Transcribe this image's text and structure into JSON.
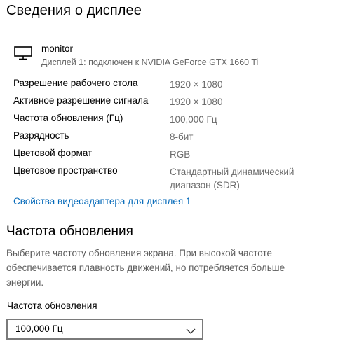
{
  "page_title": "Сведения о дисплее",
  "monitor": {
    "icon": "monitor-icon",
    "name": "monitor",
    "subtitle": "Дисплей 1: подключен к NVIDIA GeForce GTX 1660 Ti"
  },
  "info": [
    {
      "label": "Разрешение рабочего стола",
      "value": "1920 × 1080"
    },
    {
      "label": "Активное разрешение сигнала",
      "value": "1920 × 1080"
    },
    {
      "label": "Частота обновления (Гц)",
      "value": "100,000 Гц"
    },
    {
      "label": "Разрядность",
      "value": "8-бит"
    },
    {
      "label": "Цветовой формат",
      "value": "RGB"
    },
    {
      "label": "Цветовое пространство",
      "value": "Стандартный динамический диапазон (SDR)"
    }
  ],
  "adapter_link": "Свойства видеоадаптера для дисплея 1",
  "refresh_section": {
    "title": "Частота обновления",
    "description": "Выберите частоту обновления экрана. При высокой частоте обеспечивается плавность движений, но потребляется больше энергии.",
    "field_label": "Частота обновления",
    "selected_value": "100,000 Гц",
    "dropdown_icon": "chevron-down-icon"
  },
  "colors": {
    "link": "#0067b8",
    "secondary_text": "#6b6b6b",
    "dropdown_border": "#7a7a7a"
  }
}
